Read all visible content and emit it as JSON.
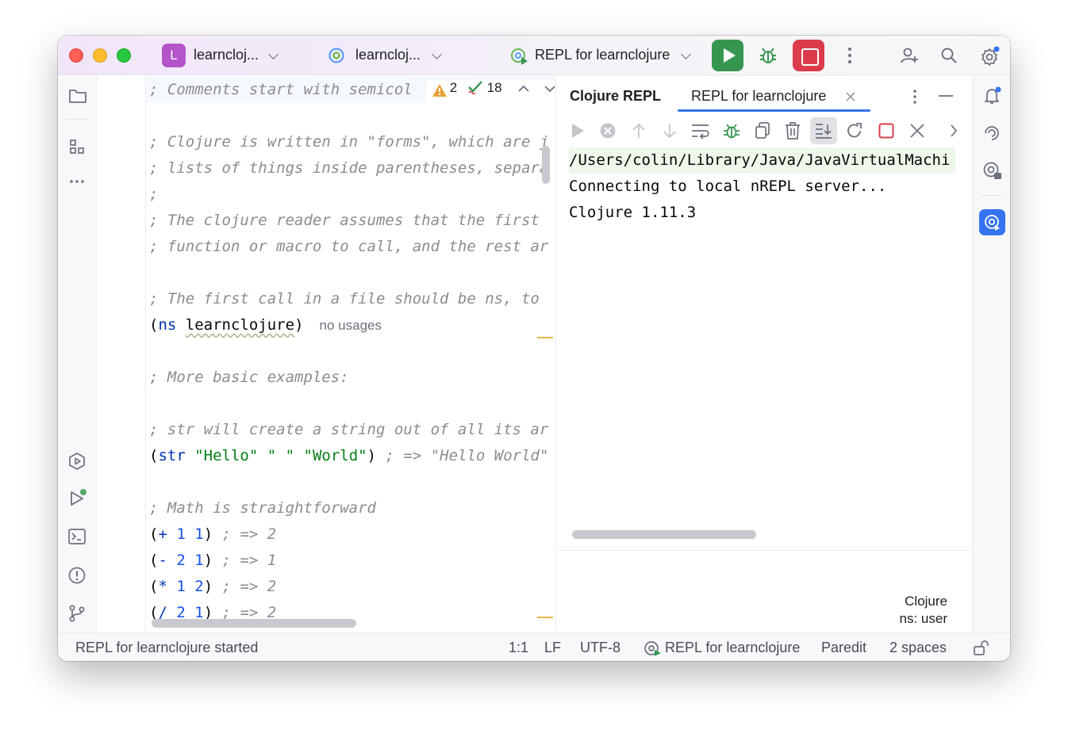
{
  "titlebar": {
    "project_badge": "L",
    "project_name": "learncloj...",
    "vcs_name": "learncloj...",
    "run_config": "REPL for learnclojure",
    "icons": [
      "run-icon",
      "debug-icon",
      "stop-icon",
      "more-vertical-icon",
      "add-user-icon",
      "search-icon",
      "settings-icon"
    ]
  },
  "left_tools": [
    "folder-icon",
    "structure-icon",
    "more-horizontal-icon",
    "services-icon",
    "run-dashboard-icon",
    "terminal-icon",
    "problems-icon",
    "git-branch-icon"
  ],
  "right_tools": [
    "notifications-icon",
    "ai-assistant-icon",
    "clojure-repl-icon",
    "repl-active-icon"
  ],
  "editor": {
    "inspection": {
      "warnings": "2",
      "ok_count": "18"
    },
    "inlay_hint": "no usages",
    "lines": {
      "l1": "; Comments start with semicol",
      "l3": "; Clojure is written in \"forms\", which are j",
      "l4": "; lists of things inside parentheses, separa",
      "l5": ";",
      "l6": "; The clojure reader assumes that the first ",
      "l7": "; function or macro to call, and the rest ar",
      "l9": "; The first call in a file should be ns, to ",
      "l10_fn": "ns",
      "l10_name": "learnclojure",
      "l12": "; More basic examples:",
      "l14": "; str will create a string out of all its ar",
      "l15_fn": "str",
      "l15_s1": "\"Hello\"",
      "l15_s2": "\" \"",
      "l15_s3": "\"World\"",
      "l15_c": "; => \"Hello World\"",
      "l17": "; Math is straightforward",
      "l18_fn": "+",
      "l18_a": "1",
      "l18_b": "1",
      "l18_c": "; => 2",
      "l19_fn": "-",
      "l19_a": "2",
      "l19_b": "1",
      "l19_c": "; => 1",
      "l20_fn": "*",
      "l20_a": "1",
      "l20_b": "2",
      "l20_c": "; => 2",
      "l21_fn": "/",
      "l21_a": "2",
      "l21_b": "1",
      "l21_c": "; => 2"
    }
  },
  "repl": {
    "tab_title": "Clojure REPL",
    "tab_session": "REPL for learnclojure",
    "toolbar_icons": [
      "execute-icon",
      "interrupt-icon",
      "history-up-icon",
      "history-down-icon",
      "soft-wrap-icon",
      "debug-icon",
      "copy-icon",
      "clear-icon",
      "scroll-to-end-icon",
      "reload-icon",
      "stop-icon",
      "close-icon",
      "chevron-right-icon"
    ],
    "output": [
      "/Users/colin/Library/Java/JavaVirtualMachi",
      "Connecting to local nREPL server...",
      "Clojure 1.11.3"
    ],
    "lang": "Clojure",
    "ns": "ns: user"
  },
  "statusbar": {
    "message": "REPL for learnclojure started",
    "position": "1:1",
    "line_sep": "LF",
    "encoding": "UTF-8",
    "repl": "REPL for learnclojure",
    "mode": "Paredit",
    "indent": "2 spaces"
  }
}
